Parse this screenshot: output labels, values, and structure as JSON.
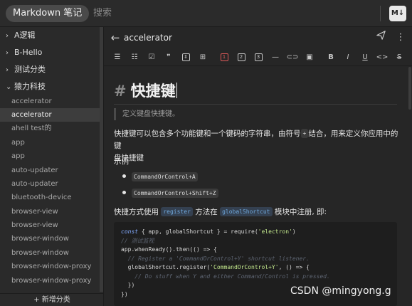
{
  "topbar": {
    "app_title": "Markdown 笔记",
    "search_label": "搜索",
    "mode_badge": "M↓"
  },
  "sidebar": {
    "categories": [
      {
        "chevron": "›",
        "label": "A逻辑"
      },
      {
        "chevron": "›",
        "label": "B-Hello"
      },
      {
        "chevron": "›",
        "label": "测试分类"
      },
      {
        "chevron": "⌄",
        "label": "猿力科技"
      }
    ],
    "notes": [
      "accelerator",
      "accelerator",
      "ahell test的",
      "app",
      "app",
      "auto-updater",
      "auto-updater",
      "bluetooth-device",
      "browser-view",
      "browser-view",
      "browser-window",
      "browser-window",
      "browser-window-proxy",
      "browser-window-proxy"
    ],
    "active_note_index": 1,
    "add_category_label": "+ 新增分类"
  },
  "editor": {
    "back_icon": "arrow-left-icon",
    "note_name": "accelerator",
    "send_icon": "send-icon",
    "more_icon": "more-vertical-icon"
  },
  "toolbar": {
    "items": [
      "ul-list-icon",
      "ol-list-icon",
      "task-list-icon",
      "quote-icon",
      "code-block-icon",
      "table-icon",
      "heading1-icon",
      "heading2-icon",
      "heading3-icon",
      "hr-icon",
      "link-icon",
      "image-icon",
      "bold-icon",
      "italic-icon",
      "underline-icon",
      "inline-code-icon",
      "strikethrough-icon"
    ],
    "h1": "1",
    "h2": "2",
    "h3": "3",
    "bold": "B",
    "italic": "I",
    "underline": "U",
    "quote": "❞",
    "code": "<>",
    "strike": "S"
  },
  "doc": {
    "heading_hash": "#",
    "heading": "快捷键",
    "blockquote": "定义键盘快捷键。",
    "para1_a": "快捷键可以包含多个功能键和一个键码的字符串，由符号",
    "para1_code": "+",
    "para1_b": "结合，用来定义你应用中的键",
    "para1_c": "盘快捷键",
    "example_label": "示例",
    "bullets": [
      "CommandOrControl+A",
      "CommandOrControl+Shift+Z"
    ],
    "para2_a": "快捷方式使用",
    "para2_code1": "register",
    "para2_b": "方法在",
    "para2_code2": "globalShortcut",
    "para2_c": "模块中注册, 即:",
    "code_lines": [
      "const { app, globalShortcut } = require('electron')",
      "// 测试监视",
      "app.whenReady().then(() => {",
      "  // Register a 'CommandOrControl+Y' shortcut listener.",
      "  globalShortcut.register('CommandOrControl+Y', () => {",
      "    // Do stuff when Y and either Command/Control is pressed.",
      "  })",
      "})"
    ]
  },
  "watermark": "CSDN @mingyong.g"
}
